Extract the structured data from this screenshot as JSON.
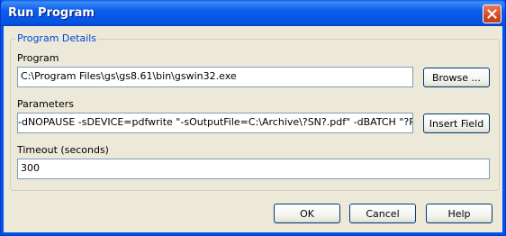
{
  "window": {
    "title": "Run Program",
    "close_icon": "close-icon"
  },
  "group": {
    "legend": "Program Details"
  },
  "program": {
    "label": "Program",
    "value": "C:\\Program Files\\gs\\gs8.61\\bin\\gswin32.exe",
    "browse_label": "Browse ..."
  },
  "parameters": {
    "label": "Parameters",
    "value": "-dNOPAUSE -sDEVICE=pdfwrite \"-sOutputFile=C:\\Archive\\?SN?.pdf\" -dBATCH \"?PF?\"",
    "insert_label": "Insert Field"
  },
  "timeout": {
    "label": "Timeout (seconds)",
    "value": "300"
  },
  "buttons": {
    "ok": "OK",
    "cancel": "Cancel",
    "help": "Help"
  },
  "colors": {
    "titlebar": "#0054e3",
    "legend": "#0046d5",
    "close": "#d24a24"
  }
}
